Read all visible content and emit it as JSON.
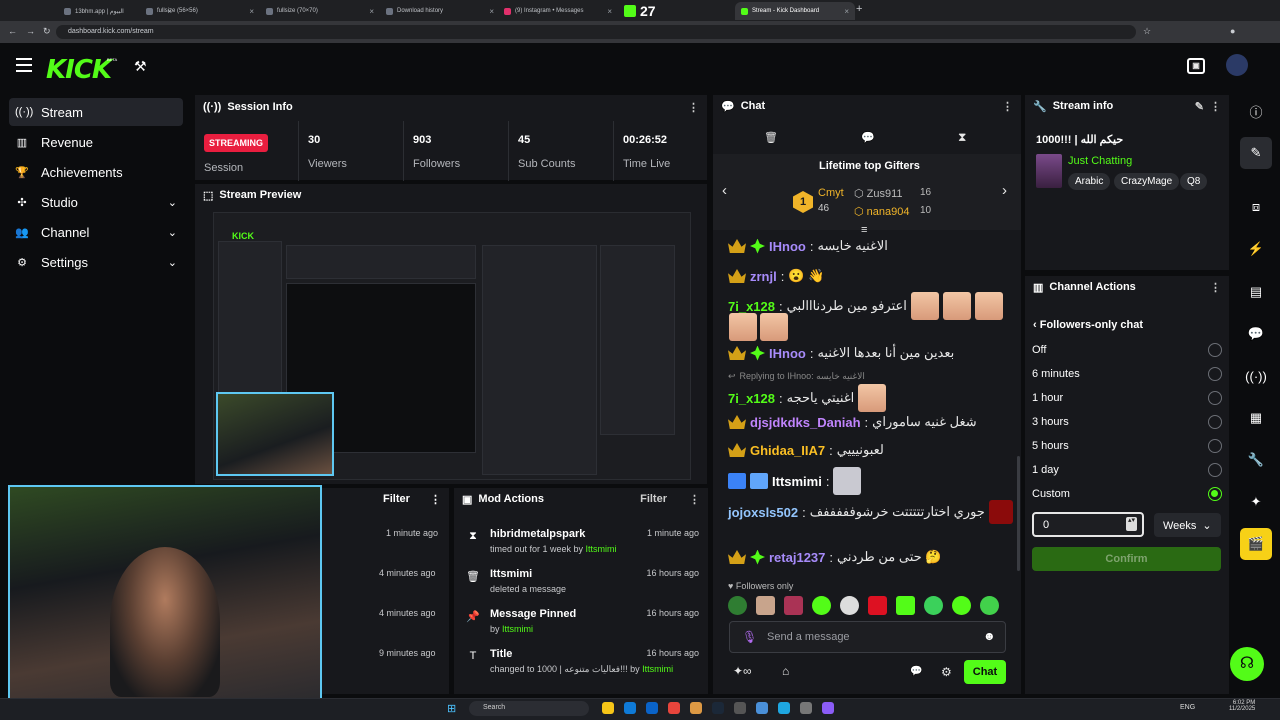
{
  "browser": {
    "tabs": [
      {
        "label": "13bhm.app | البيوم"
      },
      {
        "label": "fullsize (56×56)"
      },
      {
        "label": "fullsize (70×70)"
      },
      {
        "label": "Download history"
      },
      {
        "label": "(9) Instagram • Messages"
      },
      {
        "label": "27"
      },
      {
        "label": "Stream - Kick Dashboard"
      }
    ],
    "url": "dashboard.kick.com/stream"
  },
  "brand": {
    "logo": "KICK",
    "beta": "BETA"
  },
  "sidebar": {
    "items": [
      {
        "label": "Stream",
        "icon": "broadcast-icon"
      },
      {
        "label": "Revenue",
        "icon": "chart-icon"
      },
      {
        "label": "Achievements",
        "icon": "trophy-icon"
      },
      {
        "label": "Studio",
        "icon": "gamepad-icon"
      },
      {
        "label": "Channel",
        "icon": "people-icon"
      },
      {
        "label": "Settings",
        "icon": "gear-icon"
      }
    ]
  },
  "session": {
    "title": "Session Info",
    "badge": "STREAMING",
    "badge_label": "Session",
    "stats": [
      {
        "value": "30",
        "label": "Viewers"
      },
      {
        "value": "903",
        "label": "Followers"
      },
      {
        "value": "45",
        "label": "Sub Counts"
      },
      {
        "value": "00:26:52",
        "label": "Time Live"
      }
    ]
  },
  "preview": {
    "title": "Stream Preview"
  },
  "chat": {
    "title": "Chat",
    "gifters_title": "Lifetime top Gifters",
    "gifters": [
      {
        "rank": "1",
        "name": "Cmyt",
        "count": "46"
      },
      {
        "name": "Zus911",
        "count": "16"
      },
      {
        "name": "nana904",
        "count": "10"
      }
    ],
    "messages": [
      {
        "user": "IHnoo",
        "color": "#a78bfa",
        "text": "الاغنيه خايسه"
      },
      {
        "user": "zrnjl",
        "color": "#a78bfa",
        "text": "😮 👋"
      },
      {
        "user": "7i_x128",
        "color": "#53fc18",
        "text": "اعترفو مين طردنااالبي"
      },
      {
        "user": "IHnoo",
        "color": "#a78bfa",
        "text": "بعدين مين أنا بعدها الاغنيه"
      },
      {
        "reply": "Replying to IHnoo: الاغنيه خايسه"
      },
      {
        "user": "7i_x128",
        "color": "#53fc18",
        "text": "اغنيتي ياحجه"
      },
      {
        "user": "djsjdkdks_Daniah",
        "color": "#c084fc",
        "text": "شغل غنيه ساموراي"
      },
      {
        "user": "Ghidaa_IIA7",
        "color": "#fbbf24",
        "text": "لعبونيييي"
      },
      {
        "user": "Ittsmimi",
        "color": "#ffffff",
        "text": ""
      },
      {
        "user": "jojoxsls502",
        "color": "#93c5fd",
        "text": "جوري اختارتتتتتت خرشوفففففف"
      },
      {
        "user": "retaj1237",
        "color": "#a78bfa",
        "text": "حتى من طردني 🤔"
      }
    ],
    "followers_only": "Followers only",
    "placeholder": "Send a message",
    "send_label": "Chat"
  },
  "stream_info": {
    "title": "Stream info",
    "stream_title": "1000!!! | حيكم الله",
    "category": "Just Chatting",
    "tags": [
      "Arabic",
      "CrazyMage",
      "Q8"
    ]
  },
  "channel_actions": {
    "title": "Channel Actions",
    "sub_title": "Followers-only chat",
    "options": [
      {
        "label": "Off",
        "selected": false
      },
      {
        "label": "6 minutes",
        "selected": false
      },
      {
        "label": "1 hour",
        "selected": false
      },
      {
        "label": "3 hours",
        "selected": false
      },
      {
        "label": "5 hours",
        "selected": false
      },
      {
        "label": "1 day",
        "selected": false
      },
      {
        "label": "Custom",
        "selected": true
      }
    ],
    "custom_value": "0",
    "unit": "Weeks",
    "confirm": "Confirm"
  },
  "activity": {
    "filter": "Filter",
    "times": [
      "1 minute ago",
      "4 minutes ago",
      "4 minutes ago",
      "9 minutes ago"
    ]
  },
  "mod_actions": {
    "title": "Mod Actions",
    "filter": "Filter",
    "items": [
      {
        "title": "hibridmetalpspark",
        "prefix": "timed out for 1 week by ",
        "by": "Ittsmimi",
        "ago": "1 minute ago",
        "icon": "hourglass-icon"
      },
      {
        "title": "Ittsmimi",
        "prefix": "deleted a message",
        "by": "",
        "ago": "16 hours ago",
        "icon": "trash-icon"
      },
      {
        "title": "Message Pinned",
        "prefix": "by ",
        "by": "Ittsmimi",
        "ago": "16 hours ago",
        "icon": "pin-icon"
      },
      {
        "title": "Title",
        "prefix": "changed to 1000 | فعاليات متنوعه!!! by ",
        "by": "Ittsmimi",
        "ago": "16 hours ago",
        "icon": "text-icon"
      }
    ]
  },
  "taskbar": {
    "search": "Search",
    "lang": "ENG",
    "time": "6:02 PM",
    "date": "11/2/2025"
  },
  "colors": {
    "accent": "#53fc18",
    "live": "#e91e3f",
    "panel": "#17181c"
  }
}
